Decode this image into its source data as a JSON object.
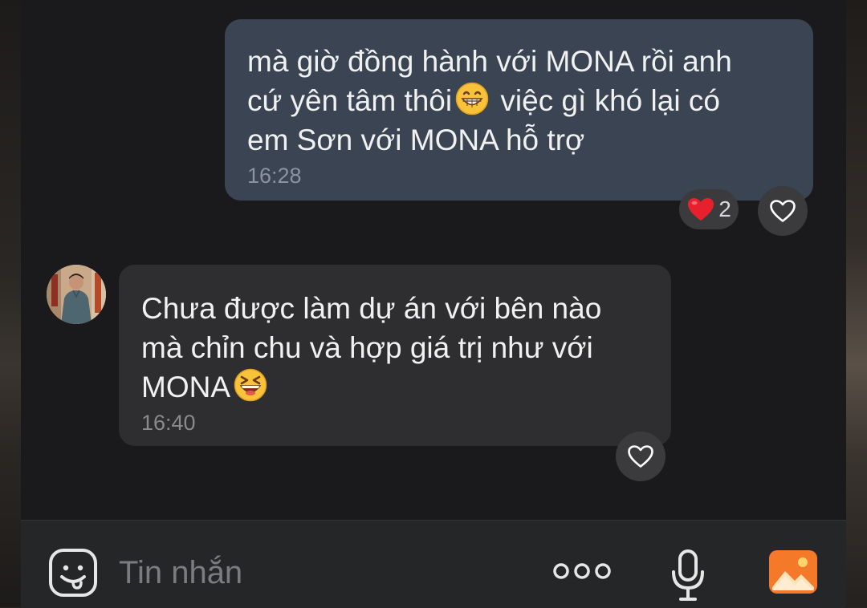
{
  "messages": [
    {
      "direction": "outgoing",
      "lines": [
        "mà giờ đồng hành với MONA rồi anh",
        "cứ yên tâm thôi",
        "việc gì khó lại có",
        "em Sơn với MONA hỗ trợ"
      ],
      "emoji": "grinning-face-emoji",
      "time": "16:28",
      "reaction": {
        "emoji": "heart",
        "count": "2"
      }
    },
    {
      "direction": "incoming",
      "lines": [
        "Chưa được làm dự án với bên nào",
        "mà chỉn chu và hợp giá trị như với",
        "MONA"
      ],
      "emoji": "laughing-face-emoji",
      "time": "16:40"
    }
  ],
  "composer": {
    "placeholder": "Tin nhắn"
  },
  "icons": {
    "sticker": "sticker-icon",
    "more": "more-options-icon",
    "mic": "microphone-icon",
    "image": "image-gallery-icon",
    "like": "heart-outline-icon",
    "reaction": "red-heart-icon"
  },
  "colors": {
    "outgoing_bubble": "#3a4452",
    "incoming_bubble": "#2e2e30",
    "background": "#1a1a1c",
    "reaction_heart": "#e8202e",
    "image_icon_accent": "#f47a2a"
  }
}
